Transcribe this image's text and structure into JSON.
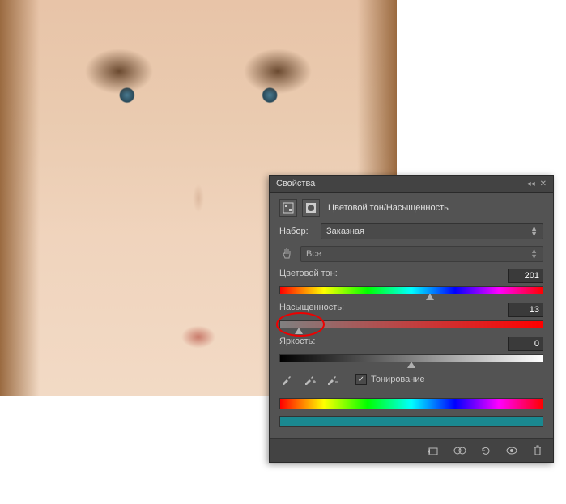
{
  "panel": {
    "title": "Свойства",
    "adjustment_name": "Цветовой тон/Насыщенность",
    "preset_label": "Набор:",
    "preset_value": "Заказная",
    "channel_value": "Все",
    "hue": {
      "label": "Цветовой тон:",
      "value": "201",
      "pos": 57
    },
    "saturation": {
      "label": "Насыщенность:",
      "value": "13",
      "pos": 7
    },
    "lightness": {
      "label": "Яркость:",
      "value": "0",
      "pos": 50
    },
    "colorize_label": "Тонирование",
    "colorize_checked": true
  },
  "icons": {
    "adj_icon1": "▦",
    "adj_icon2": "◉",
    "collapse": "◂◂",
    "close": "✕"
  }
}
